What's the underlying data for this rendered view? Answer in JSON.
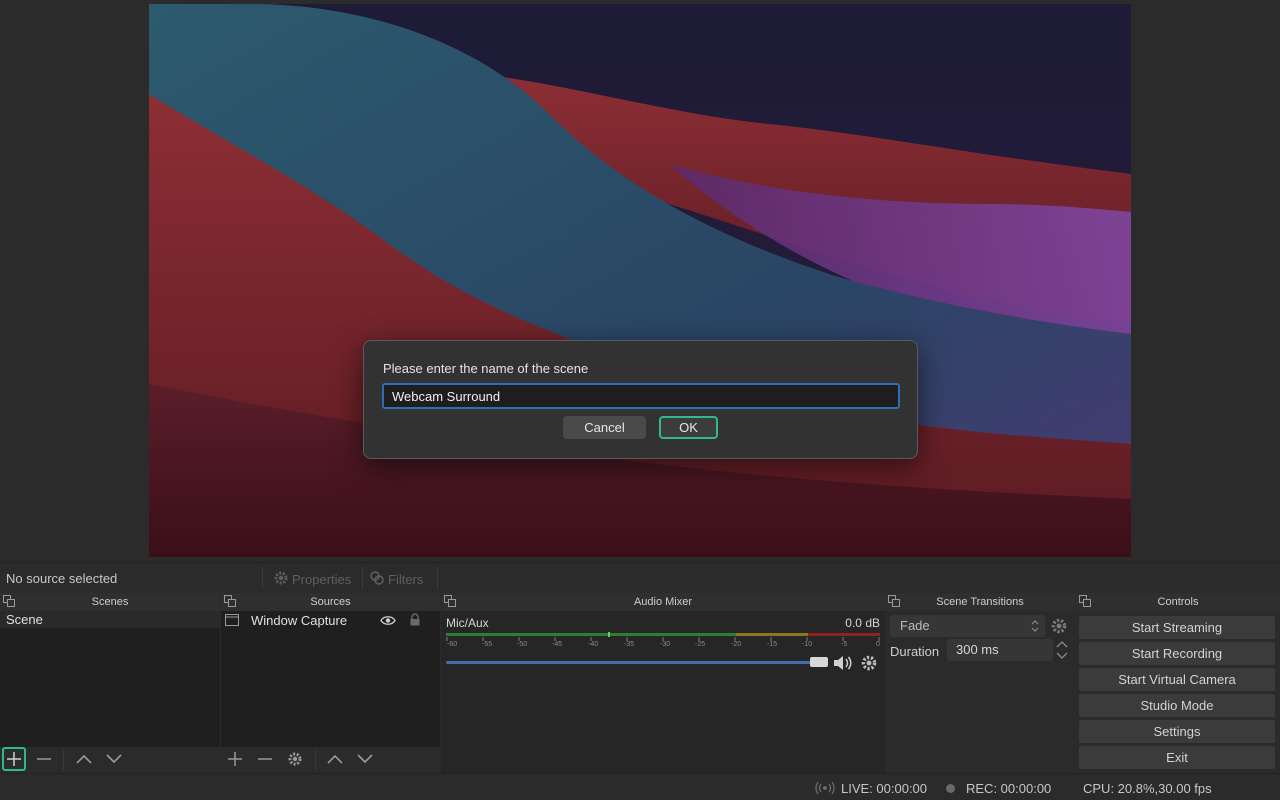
{
  "dialog": {
    "prompt": "Please enter the name of the scene",
    "input_value": "Webcam Surround",
    "cancel_label": "Cancel",
    "ok_label": "OK"
  },
  "context": {
    "no_source": "No source selected",
    "properties_label": "Properties",
    "filters_label": "Filters"
  },
  "scenes": {
    "title": "Scenes",
    "items": [
      "Scene"
    ]
  },
  "sources": {
    "title": "Sources",
    "items": [
      "Window Capture"
    ]
  },
  "mixer": {
    "title": "Audio Mixer",
    "channel_name": "Mic/Aux",
    "level": "0.0 dB",
    "ticks": [
      "-60",
      "-55",
      "-50",
      "-45",
      "-40",
      "-35",
      "-30",
      "-25",
      "-20",
      "-15",
      "-10",
      "-5",
      "0"
    ]
  },
  "transitions": {
    "title": "Scene Transitions",
    "selected": "Fade",
    "duration_label": "Duration",
    "duration_value": "300 ms"
  },
  "controls": {
    "title": "Controls",
    "buttons": [
      "Start Streaming",
      "Start Recording",
      "Start Virtual Camera",
      "Studio Mode",
      "Settings",
      "Exit"
    ]
  },
  "status": {
    "live": "LIVE: 00:00:00",
    "rec": "REC: 00:00:00",
    "cpu": "CPU: 20.8%,30.00 fps"
  },
  "colors": {
    "accent_green": "#2fb98c",
    "focus_blue": "#2f6db4",
    "meter_green": "#2e7d32",
    "meter_yellow": "#8a7a1e",
    "meter_red": "#8a2424",
    "volume_blue": "#3d6fa8"
  }
}
